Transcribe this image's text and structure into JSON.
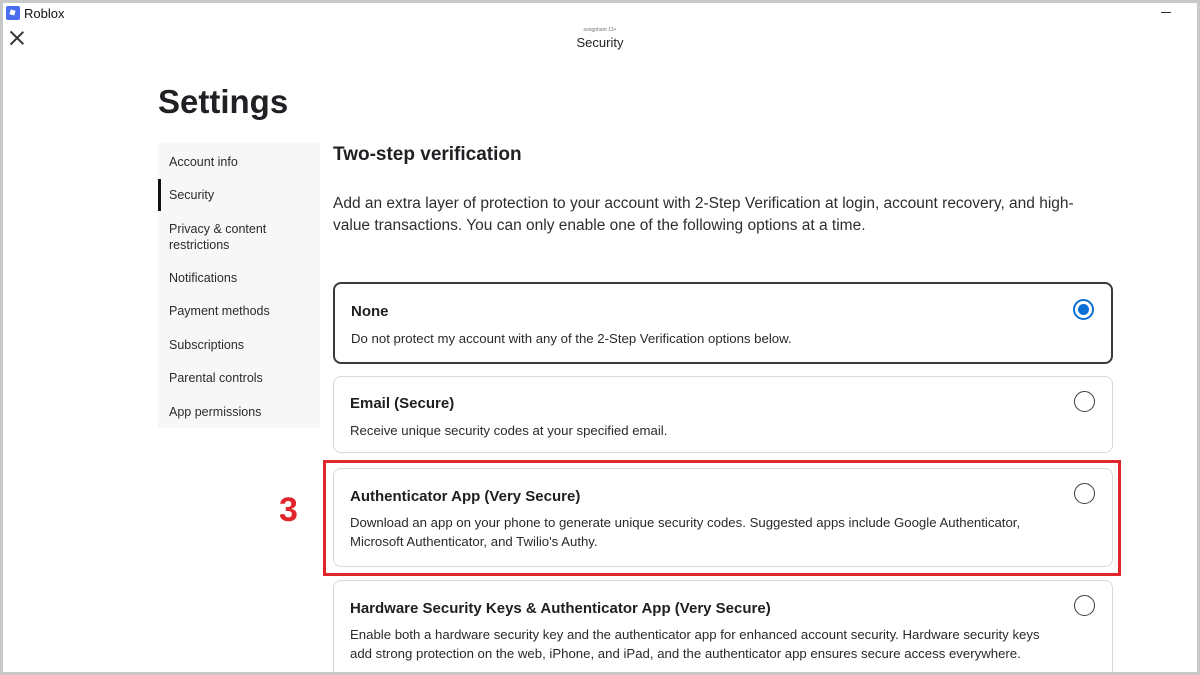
{
  "window": {
    "app_title": "Roblox"
  },
  "header": {
    "user_tag": "songpham 13+",
    "page_heading": "Security"
  },
  "settings_title": "Settings",
  "sidebar": {
    "items": [
      {
        "label": "Account info"
      },
      {
        "label": "Security"
      },
      {
        "label": "Privacy & content restrictions"
      },
      {
        "label": "Notifications"
      },
      {
        "label": "Payment methods"
      },
      {
        "label": "Subscriptions"
      },
      {
        "label": "Parental controls"
      },
      {
        "label": "App permissions"
      }
    ],
    "active": "Security"
  },
  "main": {
    "section_title": "Two-step verification",
    "section_desc": "Add an extra layer of protection to your account with 2-Step Verification at login, account recovery, and high-value transactions. You can only enable one of the following options at a time.",
    "options": [
      {
        "title": "None",
        "desc": "Do not protect my account with any of the 2-Step Verification options below.",
        "selected": true
      },
      {
        "title": "Email (Secure)",
        "desc": "Receive unique security codes at your specified email.",
        "selected": false
      },
      {
        "title": "Authenticator App (Very Secure)",
        "desc": "Download an app on your phone to generate unique security codes. Suggested apps include Google Authenticator, Microsoft Authenticator, and Twilio's Authy.",
        "selected": false
      },
      {
        "title": "Hardware Security Keys & Authenticator App (Very Secure)",
        "desc": "Enable both a hardware security key and the authenticator app for enhanced account security. Hardware security keys add strong protection on the web, iPhone, and iPad, and the authenticator app ensures secure access everywhere.",
        "selected": false
      }
    ]
  },
  "annotation": {
    "step_number": "3",
    "color": "#e0252b"
  },
  "colors": {
    "accent": "#0b6fd6"
  }
}
